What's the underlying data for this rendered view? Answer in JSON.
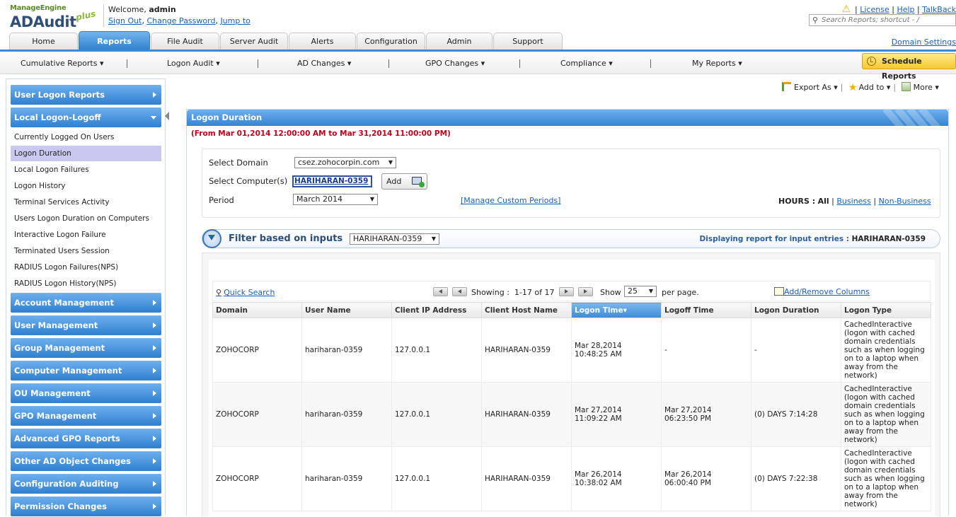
{
  "header": {
    "logo_company": "ManageEngine",
    "logo_product": "ADAudit",
    "logo_plus": "plus",
    "welcome_prefix": "Welcome,",
    "username": "admin",
    "sign_out": "Sign Out",
    "change_password": "Change Password",
    "jump_to": "Jump to",
    "license": "License",
    "help": "Help",
    "talkback": "TalkBack",
    "search_placeholder": "Search Reports; shortcut - /"
  },
  "tabs": [
    {
      "label": "Home"
    },
    {
      "label": "Reports"
    },
    {
      "label": "File Audit"
    },
    {
      "label": "Server Audit"
    },
    {
      "label": "Alerts"
    },
    {
      "label": "Configuration"
    },
    {
      "label": "Admin"
    },
    {
      "label": "Support"
    }
  ],
  "active_tab": "Reports",
  "domain_settings": "Domain Settings",
  "submenu": [
    {
      "label": "Cumulative Reports ▾"
    },
    {
      "label": "Logon Audit ▾"
    },
    {
      "label": "AD Changes ▾"
    },
    {
      "label": "GPO Changes ▾"
    },
    {
      "label": "Compliance ▾"
    },
    {
      "label": "My Reports ▾"
    }
  ],
  "schedule_reports": "Schedule Reports",
  "sidebar": {
    "top_categories": [
      {
        "label": "User Logon Reports"
      },
      {
        "label": "Local Logon-Logoff"
      }
    ],
    "items": [
      {
        "label": "Currently Logged On Users"
      },
      {
        "label": "Logon Duration"
      },
      {
        "label": "Local Logon Failures"
      },
      {
        "label": "Logon History"
      },
      {
        "label": "Terminal Services Activity"
      },
      {
        "label": "Users Logon Duration on Computers"
      },
      {
        "label": "Interactive Logon Failure"
      },
      {
        "label": "Terminated Users Session"
      },
      {
        "label": "RADIUS Logon Failures(NPS)"
      },
      {
        "label": "RADIUS Logon History(NPS)"
      }
    ],
    "active_item": "Logon Duration",
    "bottom_categories": [
      {
        "label": "Account Management"
      },
      {
        "label": "User Management"
      },
      {
        "label": "Group Management"
      },
      {
        "label": "Computer Management"
      },
      {
        "label": "OU Management"
      },
      {
        "label": "GPO Management"
      },
      {
        "label": "Advanced GPO Reports"
      },
      {
        "label": "Other AD Object Changes"
      },
      {
        "label": "Configuration Auditing"
      },
      {
        "label": "Permission Changes"
      }
    ]
  },
  "actions": {
    "export": "Export As ▾",
    "add_to": "Add to ▾",
    "more": "More ▾"
  },
  "report": {
    "title": "Logon Duration",
    "date_range": "(From Mar 01,2014 12:00:00 AM to Mar 31,2014 11:00:00 PM)",
    "select_domain_label": "Select Domain",
    "domain_value": "csez.zohocorpin.com",
    "select_computers_label": "Select Computer(s)",
    "computer_value": "HARIHARAN-0359",
    "add_button": "Add",
    "period_label": "Period",
    "period_value": "March 2014",
    "manage_custom_periods": "[Manage Custom Periods]",
    "hours_label": "HOURS :",
    "hours_all": "All",
    "hours_business": "Business",
    "hours_non_business": "Non-Business",
    "filter_label": "Filter based on inputs",
    "filter_value": "HARIHARAN-0359",
    "displaying_label": "Displaying report for input entries :",
    "displaying_value": "HARIHARAN-0359"
  },
  "grid": {
    "quick_search": "Quick Search",
    "showing_label": "Showing :",
    "showing_range": "1-17 of 17",
    "show_label": "Show",
    "per_page_value": "25",
    "per_page_label": "per page.",
    "add_remove_columns": "Add/Remove Columns",
    "columns": [
      "Domain",
      "User Name",
      "Client IP Address",
      "Client Host Name",
      "Logon Time▾",
      "Logoff Time",
      "Logon Duration",
      "Logon Type"
    ],
    "sorted_column": "Logon Time",
    "rows": [
      {
        "domain": "ZOHOCORP",
        "user": "hariharan-0359",
        "ip": "127.0.0.1",
        "host": "HARIHARAN-0359",
        "logon": "Mar 28,2014\n10:48:25 AM",
        "logoff": "-",
        "duration": "-",
        "type": "CachedInteractive (logon with cached domain credentials such as when logging on to a laptop when away from the network)"
      },
      {
        "domain": "ZOHOCORP",
        "user": "hariharan-0359",
        "ip": "127.0.0.1",
        "host": "HARIHARAN-0359",
        "logon": "Mar 27,2014\n11:09:22 AM",
        "logoff": "Mar 27,2014\n06:23:50 PM",
        "duration": "(0) DAYS 7:14:28",
        "type": "CachedInteractive (logon with cached domain credentials such as when logging on to a laptop when away from the network)"
      },
      {
        "domain": "ZOHOCORP",
        "user": "hariharan-0359",
        "ip": "127.0.0.1",
        "host": "HARIHARAN-0359",
        "logon": "Mar 26,2014\n10:38:02 AM",
        "logoff": "Mar 26,2014\n06:00:40 PM",
        "duration": "(0) DAYS 7:22:38",
        "type": "CachedInteractive (logon with cached domain credentials such as when logging on to a laptop when away from the network)"
      }
    ]
  },
  "colors": {
    "accent_blue": "#3583d2",
    "date_red": "#c0001a",
    "schedule_yellow": "#f5c932",
    "active_item": "#c8c8f0"
  }
}
